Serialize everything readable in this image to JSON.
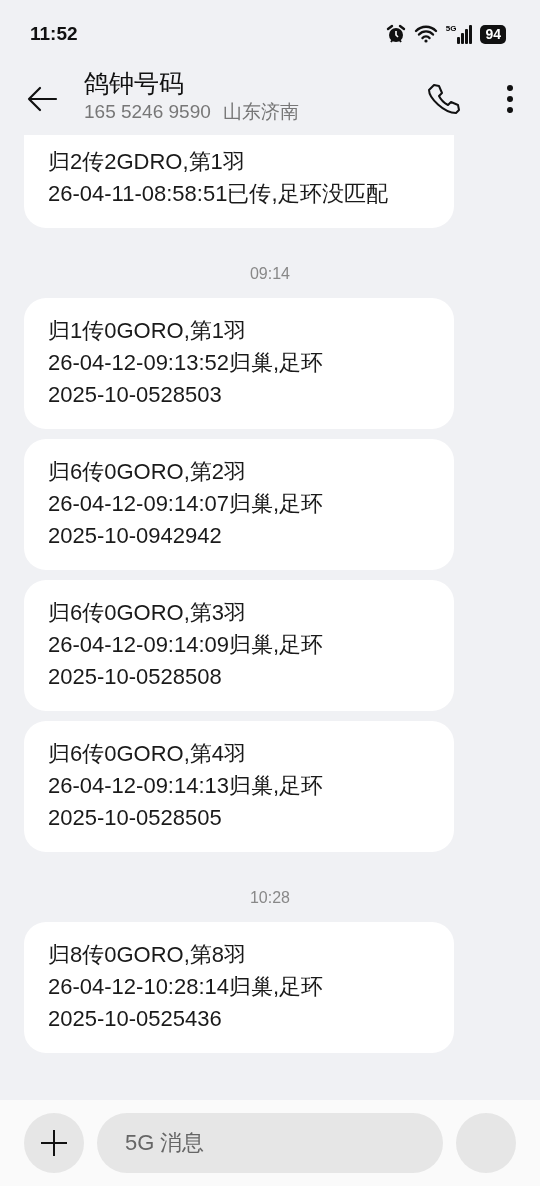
{
  "status_bar": {
    "time": "11:52",
    "network": "5G",
    "battery": "94"
  },
  "header": {
    "title": "鸽钟号码",
    "number": "165 5246 9590",
    "location": "山东济南"
  },
  "thread": [
    {
      "kind": "message",
      "text": "归2传2GDRO,第1羽\n26-04-11-08:58:51已传,足环没匹配",
      "clipped": true
    },
    {
      "kind": "time",
      "text": "09:14"
    },
    {
      "kind": "message",
      "text": "归1传0GORO,第1羽\n26-04-12-09:13:52归巢,足环\n2025-10-0528503",
      "clipped": false
    },
    {
      "kind": "message",
      "text": "归6传0GORO,第2羽\n26-04-12-09:14:07归巢,足环\n2025-10-0942942",
      "clipped": false
    },
    {
      "kind": "message",
      "text": "归6传0GORO,第3羽\n26-04-12-09:14:09归巢,足环\n2025-10-0528508",
      "clipped": false
    },
    {
      "kind": "message",
      "text": "归6传0GORO,第4羽\n26-04-12-09:14:13归巢,足环\n2025-10-0528505",
      "clipped": false
    },
    {
      "kind": "time",
      "text": "10:28"
    },
    {
      "kind": "message",
      "text": "归8传0GORO,第8羽\n26-04-12-10:28:14归巢,足环\n2025-10-0525436",
      "clipped": false
    }
  ],
  "compose": {
    "placeholder": "5G 消息"
  }
}
